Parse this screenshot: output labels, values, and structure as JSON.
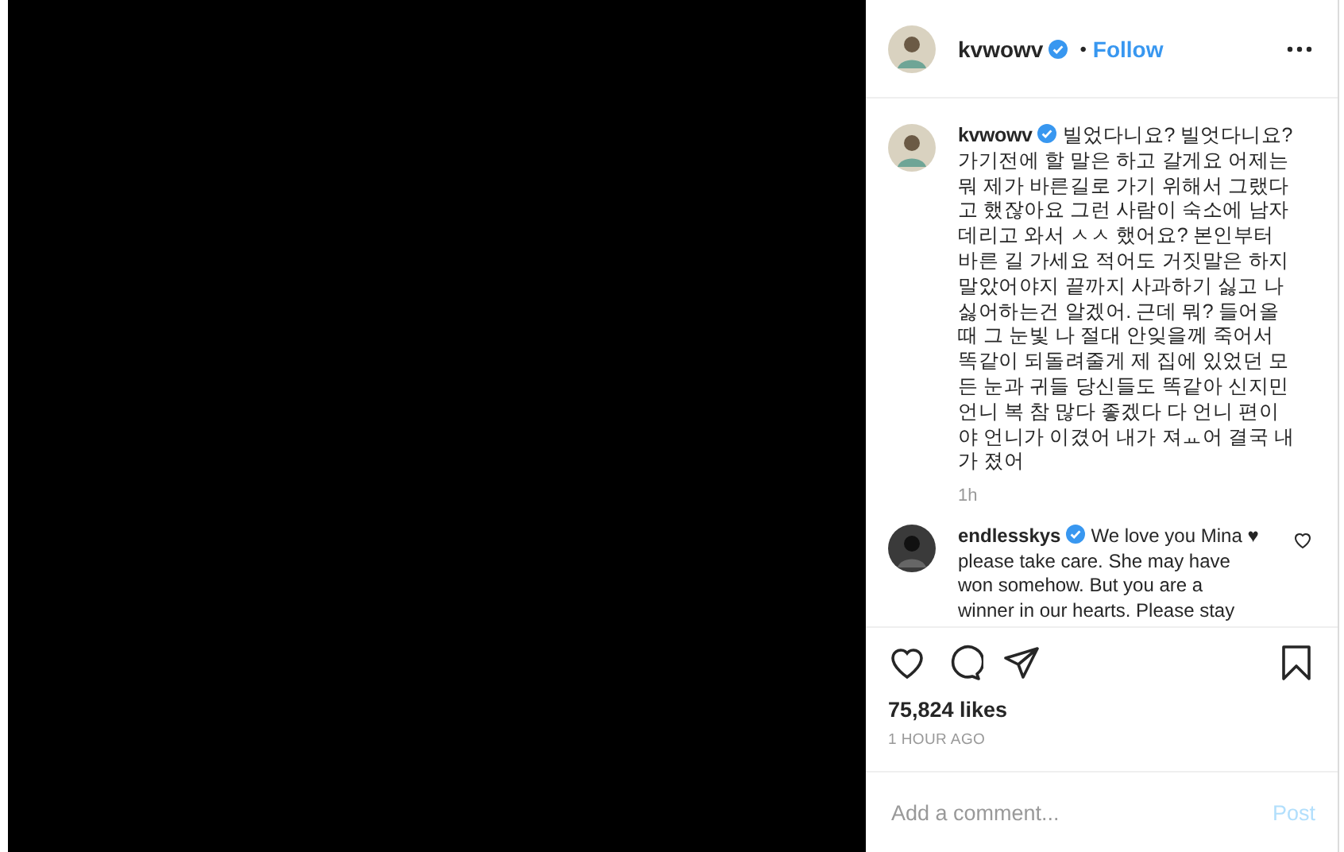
{
  "post": {
    "media": {
      "kind": "video-frame"
    },
    "header": {
      "username": "kvwowv",
      "verified": true,
      "separator": "•",
      "follow": "Follow"
    },
    "caption": {
      "username": "kvwowv",
      "verified": true,
      "text": "빌었다니요? 빌엇다니요? 가기전에 할 말은 하고 갈게요 어제는 뭐 제가 바른길로 가기 위해서 그랬다고 했잖아요 그런 사람이 숙소에 남자 데리고 와서 ㅅㅅ 했어요? 본인부터 바른 길 가세요 적어도 거짓말은 하지 말았어야지 끝까지 사과하기 싫고 나 싫어하는건 알겠어. 근데 뭐? 들어올때 그 눈빛 나 절대 안잊을께 죽어서 똑같이 되돌려줄게 제 집에 있었던 모든 눈과 귀들 당신들도 똑같아 신지민 언니 복 참 많다 좋겠다 다 언니 편이야 언니가 이겼어 내가 져ㅛ어 결국 내가 졌어",
      "time": "1h"
    },
    "comments": [
      {
        "username": "endlesskys",
        "verified": true,
        "text": "We love you Mina ♥ please take care. She may have won somehow. But you are a winner in our hearts. Please stay",
        "liked": false
      }
    ],
    "likes": "75,824 likes",
    "timestamp": "1 HOUR AGO",
    "comment_field": {
      "placeholder": "Add a comment...",
      "post": "Post"
    }
  }
}
